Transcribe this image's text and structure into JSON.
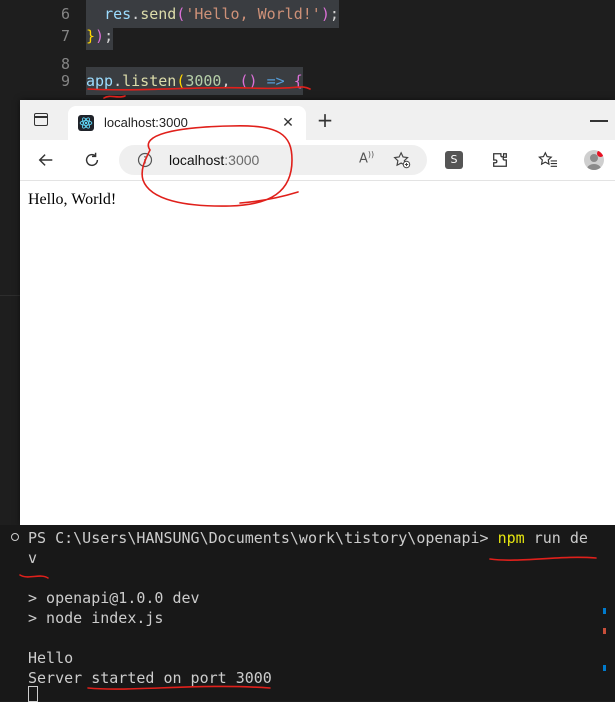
{
  "editor": {
    "lines": [
      {
        "no": "6",
        "segments": [
          {
            "t": "  ",
            "c": "indent-dots"
          },
          {
            "t": "res",
            "c": "tok-obj"
          },
          {
            "t": ".",
            "c": "tok-p"
          },
          {
            "t": "send",
            "c": "tok-fn"
          },
          {
            "t": "(",
            "c": "tok-br1"
          },
          {
            "t": "'Hello, World!'",
            "c": "tok-str"
          },
          {
            "t": ")",
            "c": "tok-br1"
          },
          {
            "t": ";",
            "c": "tok-p"
          }
        ]
      },
      {
        "no": "7",
        "segments": [
          {
            "t": "}",
            "c": "tok-br2"
          },
          {
            "t": ")",
            "c": "tok-br1"
          },
          {
            "t": ";",
            "c": "tok-p"
          }
        ]
      },
      {
        "no": "8",
        "segments": []
      },
      {
        "no": "9",
        "segments": [
          {
            "t": "app",
            "c": "tok-obj"
          },
          {
            "t": ".",
            "c": "tok-p"
          },
          {
            "t": "listen",
            "c": "tok-fn"
          },
          {
            "t": "(",
            "c": "tok-br2"
          },
          {
            "t": "3000",
            "c": "tok-num"
          },
          {
            "t": ", ",
            "c": "tok-p"
          },
          {
            "t": "()",
            "c": "tok-br1"
          },
          {
            "t": " ",
            "c": "tok-p"
          },
          {
            "t": "=>",
            "c": "tok-kw"
          },
          {
            "t": " ",
            "c": "tok-p"
          },
          {
            "t": "{",
            "c": "tok-br1"
          }
        ]
      }
    ]
  },
  "browser": {
    "tab_title": "localhost:3000",
    "address_host": "localhost",
    "address_port": ":3000",
    "read_aloud_label": "A",
    "extension_letter": "S",
    "page_text": "Hello, World!"
  },
  "terminal": {
    "prompt": "PS C:\\Users\\HANSUNG\\Documents\\work\\tistory\\openapi> ",
    "command_cmd": "npm",
    "command_args": " run de",
    "wrap": "v",
    "out1": "> openapi@1.0.0 dev",
    "out2": "> node index.js",
    "out3": "Hello",
    "out4": "Server started on port 3000"
  },
  "colors": {
    "annotation": "#e0201b",
    "accent": "#007acc"
  }
}
